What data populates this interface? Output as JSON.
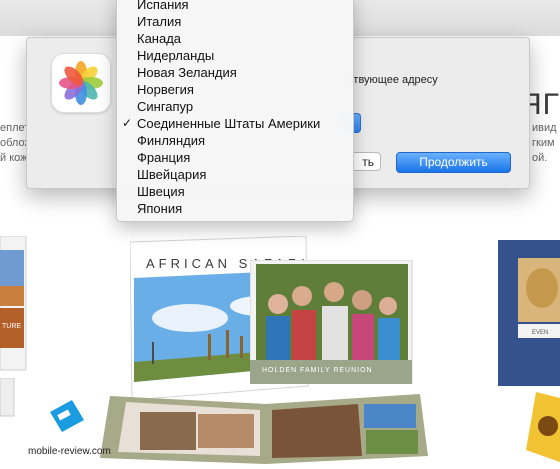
{
  "background": {
    "heading_fragment": "ЯГК",
    "left_fragments": [
      "еплет",
      "облож",
      "й кож",
      "ой."
    ],
    "right_fragments": [
      "ивид",
      "гким",
      "ой."
    ]
  },
  "dialog": {
    "text_fragment": "тствующее адресу",
    "back_button": "ть",
    "continue_button": "Продолжить"
  },
  "country_menu": {
    "selected": "Соединенные Штаты Америки",
    "items": [
      {
        "label": "Испания",
        "checked": false
      },
      {
        "label": "Италия",
        "checked": false
      },
      {
        "label": "Канада",
        "checked": false
      },
      {
        "label": "Нидерланды",
        "checked": false
      },
      {
        "label": "Новая Зеландия",
        "checked": false
      },
      {
        "label": "Норвегия",
        "checked": false
      },
      {
        "label": "Сингапур",
        "checked": false
      },
      {
        "label": "Соединенные Штаты Америки",
        "checked": true
      },
      {
        "label": "Финляндия",
        "checked": false
      },
      {
        "label": "Франция",
        "checked": false
      },
      {
        "label": "Швейцария",
        "checked": false
      },
      {
        "label": "Швеция",
        "checked": false
      },
      {
        "label": "Япония",
        "checked": false
      }
    ],
    "check_glyph": "✓"
  },
  "books": {
    "safari_title": "AFRICAN SAFARI",
    "family_title": "HOLDEN FAMILY REUNION",
    "left_book_fragment": "TURE",
    "right_book_fragment": "EVEN"
  },
  "watermark": {
    "text": "mobile-review.com"
  },
  "icons": {
    "app": "photos-icon",
    "stepper": "chevron-updown-icon",
    "check": "checkmark-icon"
  },
  "colors": {
    "accent": "#1a73e8",
    "menu_bg": "#f6f6f6",
    "dialog_bg": "#ececec"
  }
}
